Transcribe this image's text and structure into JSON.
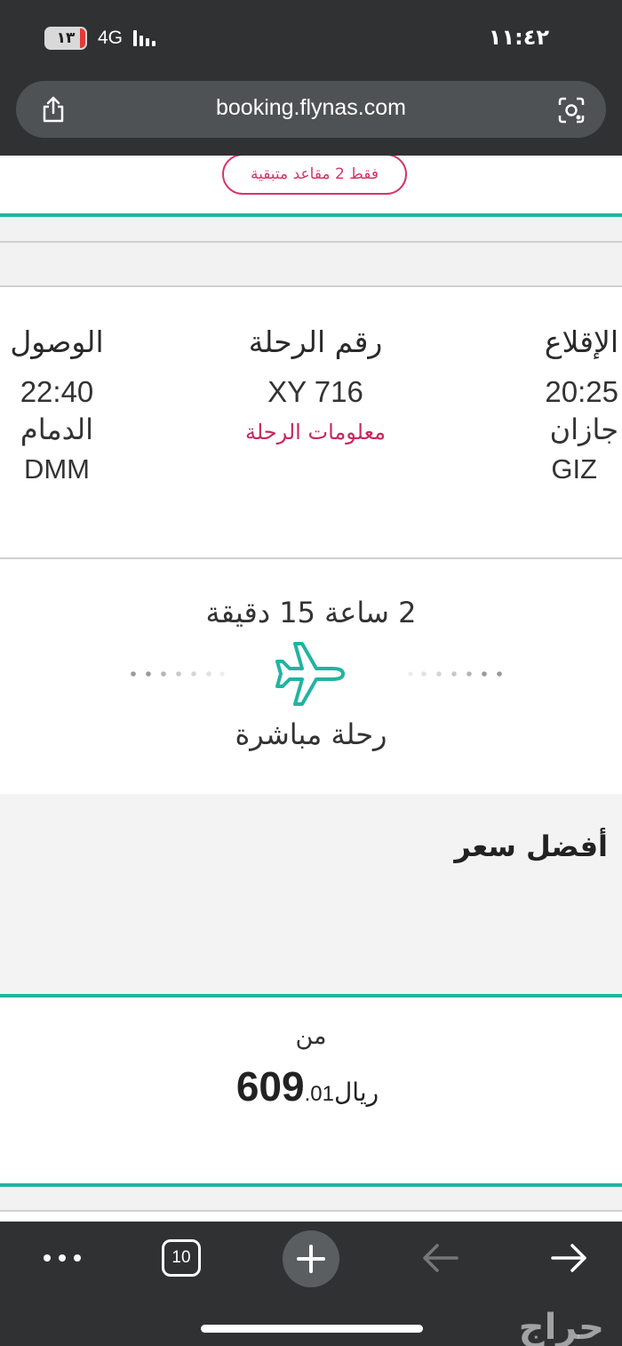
{
  "status_bar": {
    "battery": "١٣",
    "network": "4G",
    "time": "١١:٤٢"
  },
  "browser": {
    "url": "booking.flynas.com",
    "tab_count": "10"
  },
  "flight": {
    "seats_left": "فقط 2 مقاعد متبقية",
    "departure": {
      "label": "الإقلاع",
      "time": "20:25",
      "city": "جازان",
      "code": "GIZ"
    },
    "flight_number": {
      "label": "رقم الرحلة",
      "value": "XY 716",
      "info_link": "معلومات الرحلة"
    },
    "arrival": {
      "label": "الوصول",
      "time": "22:40",
      "city": "الدمام",
      "code": "DMM"
    },
    "duration": "2 ساعة 15 دقيقة",
    "stops": "رحلة مباشرة"
  },
  "pricing": {
    "best_price_label": "أفضل سعر",
    "from_label": "من",
    "amount": "609",
    "decimal": ".01",
    "currency": "ريال"
  },
  "watermark": "حراج",
  "colors": {
    "accent_teal": "#21b3a3",
    "accent_pink": "#c8285e",
    "chrome": "#2f3133"
  }
}
